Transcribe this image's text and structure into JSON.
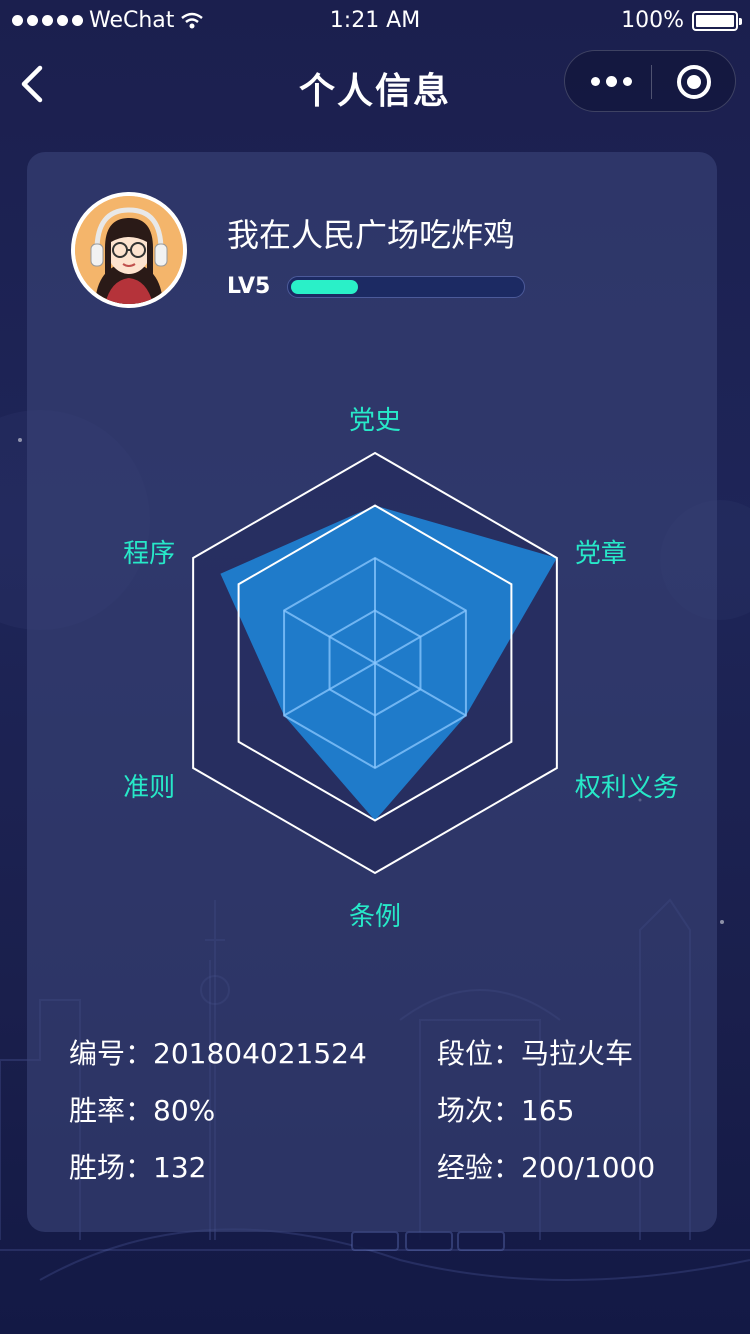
{
  "status_bar": {
    "carrier": "WeChat",
    "time": "1:21 AM",
    "battery": "100%"
  },
  "nav": {
    "title": "个人信息",
    "back_icon": "chevron-left-icon",
    "more_icon": "more-dots-icon",
    "close_icon": "target-circle-icon"
  },
  "profile": {
    "username": "我在人民广场吃炸鸡",
    "level": "LV5",
    "level_progress": 0.29,
    "avatar_icon": "avatar-girl-headphones"
  },
  "chart_data": {
    "type": "radar",
    "axes": [
      "党史",
      "党章",
      "权利义务",
      "条例",
      "准则",
      "程序"
    ],
    "values": [
      0.75,
      1.0,
      0.5,
      0.75,
      0.5,
      0.85
    ],
    "rings": 4,
    "fill_color": "#1f84d6",
    "label_color": "#27e8c8"
  },
  "stats": {
    "left": [
      {
        "label": "编号：",
        "value": "201804021524"
      },
      {
        "label": "胜率：",
        "value": "80%"
      },
      {
        "label": "胜场：",
        "value": "132"
      }
    ],
    "right": [
      {
        "label": "段位：",
        "value": "马拉火车"
      },
      {
        "label": "场次：",
        "value": "165"
      },
      {
        "label": "经验：",
        "value": "200/1000"
      }
    ]
  }
}
